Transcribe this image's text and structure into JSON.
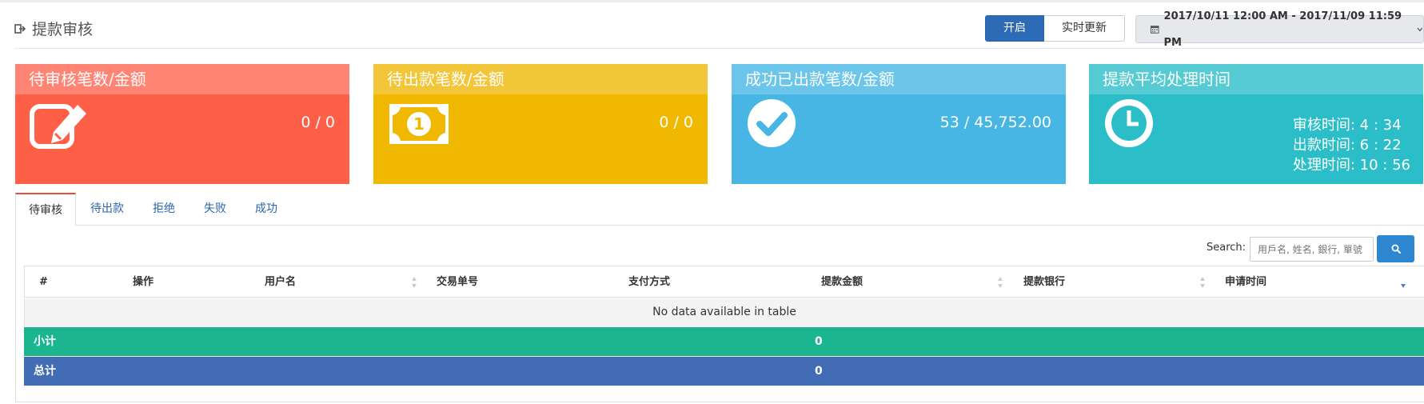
{
  "page": {
    "title": "提款审核",
    "title_icon": "sign-out-icon"
  },
  "toolbar": {
    "toggle_on_label": "开启",
    "realtime_label": "实时更新",
    "date_range": "2017/10/11 12:00 AM - 2017/11/09 11:59 PM"
  },
  "cards": [
    {
      "title": "待审核笔数/金额",
      "value": "0 / 0",
      "icon": "edit-icon",
      "color": "#fe5f47"
    },
    {
      "title": "待出款笔数/金额",
      "value": "0 / 0",
      "icon": "money-bill-icon",
      "color": "#f0b800"
    },
    {
      "title": "成功已出款笔数/金额",
      "value": "53 / 45,752.00",
      "icon": "check-circle-icon",
      "color": "#47b6e4"
    },
    {
      "title": "提款平均处理时间",
      "icon": "clock-icon",
      "color": "#2cbec8",
      "times": [
        "审核时间: 4 : 34",
        "出款时间: 6 : 22",
        "处理时间: 10 : 56"
      ]
    }
  ],
  "tabs": [
    "待审核",
    "待出款",
    "拒绝",
    "失败",
    "成功"
  ],
  "search": {
    "label": "Search:",
    "placeholder": "用戶名, 姓名, 銀行, 單號"
  },
  "table": {
    "columns": [
      "#",
      "操作",
      "用户名",
      "交易单号",
      "支付方式",
      "提款金额",
      "提款银行",
      "申请时间"
    ],
    "empty_message": "No data available in table",
    "subtotal_label": "小计",
    "subtotal_value": "0",
    "total_label": "总计",
    "total_value": "0"
  }
}
